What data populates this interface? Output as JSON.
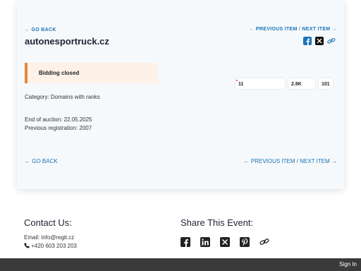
{
  "item": {
    "back_label": "← GO BACK",
    "title": "autonesportruck.cz",
    "prev_label": "← PREVIOUS ITEM",
    "next_label": "NEXT ITEM →",
    "separator": "/",
    "status": "Bidding closed",
    "category": "Category: Domains with ranks",
    "end_of_auction": "End of auction: 22.05.2025",
    "previous_registration": "Previous registration: 2007",
    "back_bottom": "← GO BACK",
    "prev_bottom": "← PREVIOUS ITEM",
    "next_bottom": "NEXT ITEM →",
    "share_icons": [
      "facebook-icon",
      "x-icon",
      "link-icon"
    ]
  },
  "stats": [
    {
      "label": "",
      "value": "11",
      "width": 50
    },
    {
      "label": "",
      "value": "2.8K",
      "width": 22
    },
    {
      "label": "",
      "value": "101",
      "width": 20
    }
  ],
  "footer": {
    "contact_heading": "Contact Us:",
    "email": "Email: info@regit.cz",
    "phone": "+420 603 203 203",
    "share_heading": "Share This Event:",
    "share_icons": [
      "facebook-icon",
      "linkedin-icon",
      "x-icon",
      "pinterest-icon",
      "link-icon"
    ],
    "signin": "Sign In"
  },
  "colors": {
    "accent": "#1a73b6",
    "status_bar": "#e8873a",
    "status_bg": "#fdf1e8",
    "footer_bar": "#3a3a3a"
  }
}
